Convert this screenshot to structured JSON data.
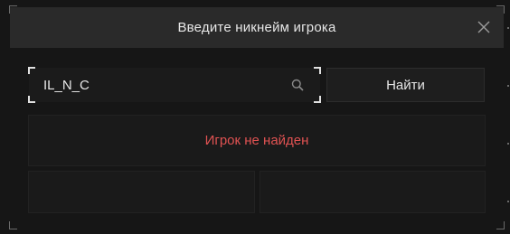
{
  "dialog": {
    "title": "Введите никнейм игрока",
    "close_icon": "close-icon"
  },
  "search": {
    "value": "IL_N_C",
    "icon": "search-icon"
  },
  "find_button": {
    "label": "Найти"
  },
  "result": {
    "message": "Игрок не найден",
    "color": "#e05252"
  },
  "colors": {
    "header_bg": "#2a2a2a",
    "panel_bg": "#1a1a1a",
    "error": "#e05252"
  }
}
